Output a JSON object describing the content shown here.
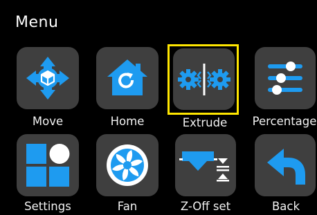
{
  "menu": {
    "title": "Menu",
    "items": [
      {
        "label": "Move",
        "icon": "move-arrows-cube-icon"
      },
      {
        "label": "Home",
        "icon": "home-icon"
      },
      {
        "label": "Extrude",
        "icon": "extrude-gears-icon",
        "selected": true
      },
      {
        "label": "Percentage",
        "icon": "sliders-icon"
      },
      {
        "label": "Settings",
        "icon": "settings-grid-icon"
      },
      {
        "label": "Fan",
        "icon": "fan-icon"
      },
      {
        "label": "Z-Off set",
        "icon": "z-offset-icon"
      },
      {
        "label": "Back",
        "icon": "back-arrow-icon"
      }
    ]
  },
  "colors": {
    "accent": "#1e9bf0",
    "tile": "#3f3f3f",
    "selection": "#ffe600",
    "background": "#000000"
  }
}
